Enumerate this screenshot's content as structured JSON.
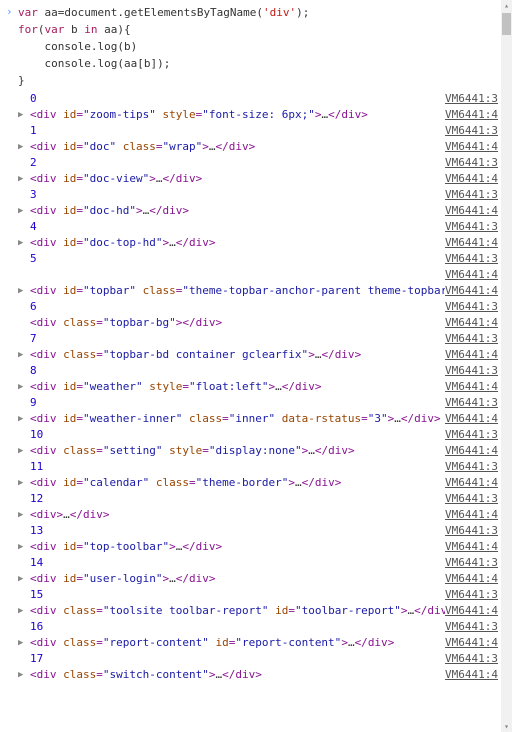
{
  "input": {
    "line1_a": "var",
    "line1_b": " aa=document.getElementsByTagName(",
    "line1_c": "'div'",
    "line1_d": ");",
    "line2_a": "for",
    "line2_b": "(",
    "line2_c": "var",
    "line2_d": " b ",
    "line2_e": "in",
    "line2_f": " aa){",
    "line3": "    console.log(b)",
    "line4": "    console.log(aa[b]);",
    "line5": "}"
  },
  "source3": "VM6441:3",
  "source4": "VM6441:4",
  "rows": [
    {
      "type": "num",
      "value": "0"
    },
    {
      "type": "el",
      "parts": [
        "div",
        " id",
        "=",
        "\"zoom-tips\"",
        " style",
        "=",
        "\"font-size: 6px;\""
      ],
      "ell": true
    },
    {
      "type": "num",
      "value": "1"
    },
    {
      "type": "el",
      "parts": [
        "div",
        " id",
        "=",
        "\"doc\"",
        " class",
        "=",
        "\"wrap\""
      ],
      "ell": true
    },
    {
      "type": "num",
      "value": "2"
    },
    {
      "type": "el",
      "parts": [
        "div",
        " id",
        "=",
        "\"doc-view\""
      ],
      "ell": true
    },
    {
      "type": "num",
      "value": "3"
    },
    {
      "type": "el",
      "parts": [
        "div",
        " id",
        "=",
        "\"doc-hd\""
      ],
      "ell": true
    },
    {
      "type": "num",
      "value": "4"
    },
    {
      "type": "el",
      "parts": [
        "div",
        " id",
        "=",
        "\"doc-top-hd\""
      ],
      "ell": true
    },
    {
      "type": "num",
      "value": "5"
    },
    {
      "type": "blank"
    },
    {
      "type": "el",
      "parts": [
        "div",
        " id",
        "=",
        "\"topbar\"",
        " class",
        "=",
        "\"theme-topbar-anchor-parent theme-topbar\""
      ],
      "ell": true
    },
    {
      "type": "num",
      "value": "6"
    },
    {
      "type": "el-noexp",
      "parts": [
        "div",
        " class",
        "=",
        "\"topbar-bg\""
      ],
      "ell": false
    },
    {
      "type": "num",
      "value": "7"
    },
    {
      "type": "el",
      "parts": [
        "div",
        " class",
        "=",
        "\"topbar-bd container gclearfix\""
      ],
      "ell": true
    },
    {
      "type": "num",
      "value": "8"
    },
    {
      "type": "el",
      "parts": [
        "div",
        " id",
        "=",
        "\"weather\"",
        " style",
        "=",
        "\"float:left\""
      ],
      "ell": true
    },
    {
      "type": "num",
      "value": "9"
    },
    {
      "type": "el",
      "parts": [
        "div",
        " id",
        "=",
        "\"weather-inner\"",
        " class",
        "=",
        "\"inner\"",
        " data-rstatus",
        "=",
        "\"3\""
      ],
      "ell": true
    },
    {
      "type": "num",
      "value": "10"
    },
    {
      "type": "el",
      "parts": [
        "div",
        " class",
        "=",
        "\"setting\"",
        " style",
        "=",
        "\"display:none\""
      ],
      "ell": true
    },
    {
      "type": "num",
      "value": "11"
    },
    {
      "type": "el",
      "parts": [
        "div",
        " id",
        "=",
        "\"calendar\"",
        " class",
        "=",
        "\"theme-border\""
      ],
      "ell": true
    },
    {
      "type": "num",
      "value": "12"
    },
    {
      "type": "el",
      "parts": [
        "div"
      ],
      "ell": true
    },
    {
      "type": "num",
      "value": "13"
    },
    {
      "type": "el",
      "parts": [
        "div",
        " id",
        "=",
        "\"top-toolbar\""
      ],
      "ell": true
    },
    {
      "type": "num",
      "value": "14"
    },
    {
      "type": "el",
      "parts": [
        "div",
        " id",
        "=",
        "\"user-login\""
      ],
      "ell": true
    },
    {
      "type": "num",
      "value": "15"
    },
    {
      "type": "el",
      "parts": [
        "div",
        " class",
        "=",
        "\"toolsite toolbar-report\"",
        " id",
        "=",
        "\"toolbar-report\""
      ],
      "ell": true
    },
    {
      "type": "num",
      "value": "16"
    },
    {
      "type": "el",
      "parts": [
        "div",
        " class",
        "=",
        "\"report-content\"",
        " id",
        "=",
        "\"report-content\""
      ],
      "ell": true
    },
    {
      "type": "num",
      "value": "17"
    },
    {
      "type": "el",
      "parts": [
        "div",
        " class",
        "=",
        "\"switch-content\""
      ],
      "ell": true
    }
  ]
}
